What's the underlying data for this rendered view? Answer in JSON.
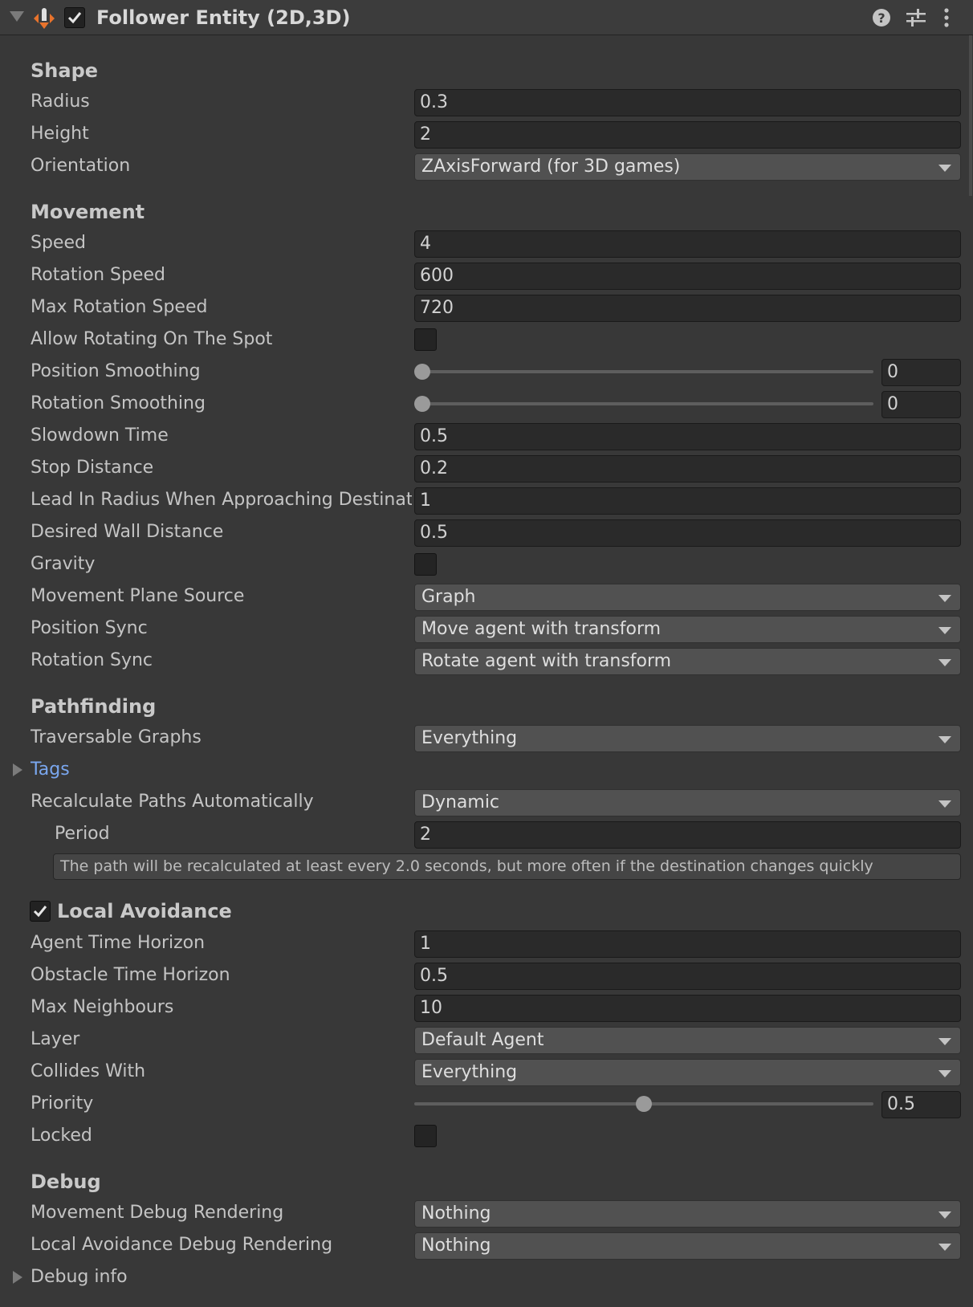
{
  "header": {
    "title": "Follower Entity (2D,3D)",
    "enabled": true,
    "icons": [
      "fold-arrow-icon",
      "follower-entity-component-icon",
      "help-icon",
      "presets-icon",
      "kebab-menu-icon"
    ]
  },
  "colors": {
    "background": "#383838",
    "field": "#2a2a2a",
    "dropdown": "#515151",
    "link": "#7aa7ef",
    "icon_orange": "#e8732c"
  },
  "shape": {
    "title": "Shape",
    "radius_label": "Radius",
    "radius_value": "0.3",
    "height_label": "Height",
    "height_value": "2",
    "orientation_label": "Orientation",
    "orientation_value": "ZAxisForward (for 3D games)"
  },
  "movement": {
    "title": "Movement",
    "speed_label": "Speed",
    "speed_value": "4",
    "rotation_speed_label": "Rotation Speed",
    "rotation_speed_value": "600",
    "max_rotation_speed_label": "Max Rotation Speed",
    "max_rotation_speed_value": "720",
    "allow_rotating_label": "Allow Rotating On The Spot",
    "allow_rotating_checked": false,
    "position_smoothing_label": "Position Smoothing",
    "position_smoothing_value": "0",
    "position_smoothing_fraction": 0,
    "rotation_smoothing_label": "Rotation Smoothing",
    "rotation_smoothing_value": "0",
    "rotation_smoothing_fraction": 0,
    "slowdown_time_label": "Slowdown Time",
    "slowdown_time_value": "0.5",
    "stop_distance_label": "Stop Distance",
    "stop_distance_value": "0.2",
    "lead_in_label": "Lead In Radius When Approaching Destination",
    "lead_in_value": "1",
    "desired_wall_distance_label": "Desired Wall Distance",
    "desired_wall_distance_value": "0.5",
    "gravity_label": "Gravity",
    "gravity_checked": false,
    "movement_plane_source_label": "Movement Plane Source",
    "movement_plane_source_value": "Graph",
    "position_sync_label": "Position Sync",
    "position_sync_value": "Move agent with transform",
    "rotation_sync_label": "Rotation Sync",
    "rotation_sync_value": "Rotate agent with transform"
  },
  "pathfinding": {
    "title": "Pathfinding",
    "traversable_graphs_label": "Traversable Graphs",
    "traversable_graphs_value": "Everything",
    "tags_label": "Tags",
    "recalculate_label": "Recalculate Paths Automatically",
    "recalculate_value": "Dynamic",
    "period_label": "Period",
    "period_value": "2",
    "help_text": "The path will be recalculated at least every 2.0 seconds, but more often if the destination changes quickly"
  },
  "local_avoidance": {
    "title": "Local Avoidance",
    "enabled": true,
    "agent_time_horizon_label": "Agent Time Horizon",
    "agent_time_horizon_value": "1",
    "obstacle_time_horizon_label": "Obstacle Time Horizon",
    "obstacle_time_horizon_value": "0.5",
    "max_neighbours_label": "Max Neighbours",
    "max_neighbours_value": "10",
    "layer_label": "Layer",
    "layer_value": "Default Agent",
    "collides_with_label": "Collides With",
    "collides_with_value": "Everything",
    "priority_label": "Priority",
    "priority_value": "0.5",
    "priority_fraction": 0.5,
    "locked_label": "Locked",
    "locked_checked": false
  },
  "debug": {
    "title": "Debug",
    "movement_debug_label": "Movement Debug Rendering",
    "movement_debug_value": "Nothing",
    "local_avoidance_debug_label": "Local Avoidance Debug Rendering",
    "local_avoidance_debug_value": "Nothing",
    "debug_info_label": "Debug info"
  }
}
